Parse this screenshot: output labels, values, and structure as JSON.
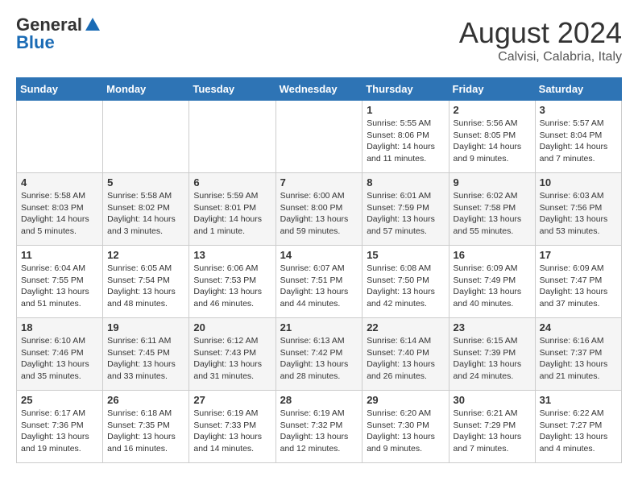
{
  "header": {
    "logo_general": "General",
    "logo_blue": "Blue",
    "month": "August 2024",
    "location": "Calvisi, Calabria, Italy"
  },
  "weekdays": [
    "Sunday",
    "Monday",
    "Tuesday",
    "Wednesday",
    "Thursday",
    "Friday",
    "Saturday"
  ],
  "weeks": [
    [
      {
        "day": "",
        "detail": ""
      },
      {
        "day": "",
        "detail": ""
      },
      {
        "day": "",
        "detail": ""
      },
      {
        "day": "",
        "detail": ""
      },
      {
        "day": "1",
        "detail": "Sunrise: 5:55 AM\nSunset: 8:06 PM\nDaylight: 14 hours\nand 11 minutes."
      },
      {
        "day": "2",
        "detail": "Sunrise: 5:56 AM\nSunset: 8:05 PM\nDaylight: 14 hours\nand 9 minutes."
      },
      {
        "day": "3",
        "detail": "Sunrise: 5:57 AM\nSunset: 8:04 PM\nDaylight: 14 hours\nand 7 minutes."
      }
    ],
    [
      {
        "day": "4",
        "detail": "Sunrise: 5:58 AM\nSunset: 8:03 PM\nDaylight: 14 hours\nand 5 minutes."
      },
      {
        "day": "5",
        "detail": "Sunrise: 5:58 AM\nSunset: 8:02 PM\nDaylight: 14 hours\nand 3 minutes."
      },
      {
        "day": "6",
        "detail": "Sunrise: 5:59 AM\nSunset: 8:01 PM\nDaylight: 14 hours\nand 1 minute."
      },
      {
        "day": "7",
        "detail": "Sunrise: 6:00 AM\nSunset: 8:00 PM\nDaylight: 13 hours\nand 59 minutes."
      },
      {
        "day": "8",
        "detail": "Sunrise: 6:01 AM\nSunset: 7:59 PM\nDaylight: 13 hours\nand 57 minutes."
      },
      {
        "day": "9",
        "detail": "Sunrise: 6:02 AM\nSunset: 7:58 PM\nDaylight: 13 hours\nand 55 minutes."
      },
      {
        "day": "10",
        "detail": "Sunrise: 6:03 AM\nSunset: 7:56 PM\nDaylight: 13 hours\nand 53 minutes."
      }
    ],
    [
      {
        "day": "11",
        "detail": "Sunrise: 6:04 AM\nSunset: 7:55 PM\nDaylight: 13 hours\nand 51 minutes."
      },
      {
        "day": "12",
        "detail": "Sunrise: 6:05 AM\nSunset: 7:54 PM\nDaylight: 13 hours\nand 48 minutes."
      },
      {
        "day": "13",
        "detail": "Sunrise: 6:06 AM\nSunset: 7:53 PM\nDaylight: 13 hours\nand 46 minutes."
      },
      {
        "day": "14",
        "detail": "Sunrise: 6:07 AM\nSunset: 7:51 PM\nDaylight: 13 hours\nand 44 minutes."
      },
      {
        "day": "15",
        "detail": "Sunrise: 6:08 AM\nSunset: 7:50 PM\nDaylight: 13 hours\nand 42 minutes."
      },
      {
        "day": "16",
        "detail": "Sunrise: 6:09 AM\nSunset: 7:49 PM\nDaylight: 13 hours\nand 40 minutes."
      },
      {
        "day": "17",
        "detail": "Sunrise: 6:09 AM\nSunset: 7:47 PM\nDaylight: 13 hours\nand 37 minutes."
      }
    ],
    [
      {
        "day": "18",
        "detail": "Sunrise: 6:10 AM\nSunset: 7:46 PM\nDaylight: 13 hours\nand 35 minutes."
      },
      {
        "day": "19",
        "detail": "Sunrise: 6:11 AM\nSunset: 7:45 PM\nDaylight: 13 hours\nand 33 minutes."
      },
      {
        "day": "20",
        "detail": "Sunrise: 6:12 AM\nSunset: 7:43 PM\nDaylight: 13 hours\nand 31 minutes."
      },
      {
        "day": "21",
        "detail": "Sunrise: 6:13 AM\nSunset: 7:42 PM\nDaylight: 13 hours\nand 28 minutes."
      },
      {
        "day": "22",
        "detail": "Sunrise: 6:14 AM\nSunset: 7:40 PM\nDaylight: 13 hours\nand 26 minutes."
      },
      {
        "day": "23",
        "detail": "Sunrise: 6:15 AM\nSunset: 7:39 PM\nDaylight: 13 hours\nand 24 minutes."
      },
      {
        "day": "24",
        "detail": "Sunrise: 6:16 AM\nSunset: 7:37 PM\nDaylight: 13 hours\nand 21 minutes."
      }
    ],
    [
      {
        "day": "25",
        "detail": "Sunrise: 6:17 AM\nSunset: 7:36 PM\nDaylight: 13 hours\nand 19 minutes."
      },
      {
        "day": "26",
        "detail": "Sunrise: 6:18 AM\nSunset: 7:35 PM\nDaylight: 13 hours\nand 16 minutes."
      },
      {
        "day": "27",
        "detail": "Sunrise: 6:19 AM\nSunset: 7:33 PM\nDaylight: 13 hours\nand 14 minutes."
      },
      {
        "day": "28",
        "detail": "Sunrise: 6:19 AM\nSunset: 7:32 PM\nDaylight: 13 hours\nand 12 minutes."
      },
      {
        "day": "29",
        "detail": "Sunrise: 6:20 AM\nSunset: 7:30 PM\nDaylight: 13 hours\nand 9 minutes."
      },
      {
        "day": "30",
        "detail": "Sunrise: 6:21 AM\nSunset: 7:29 PM\nDaylight: 13 hours\nand 7 minutes."
      },
      {
        "day": "31",
        "detail": "Sunrise: 6:22 AM\nSunset: 7:27 PM\nDaylight: 13 hours\nand 4 minutes."
      }
    ]
  ]
}
